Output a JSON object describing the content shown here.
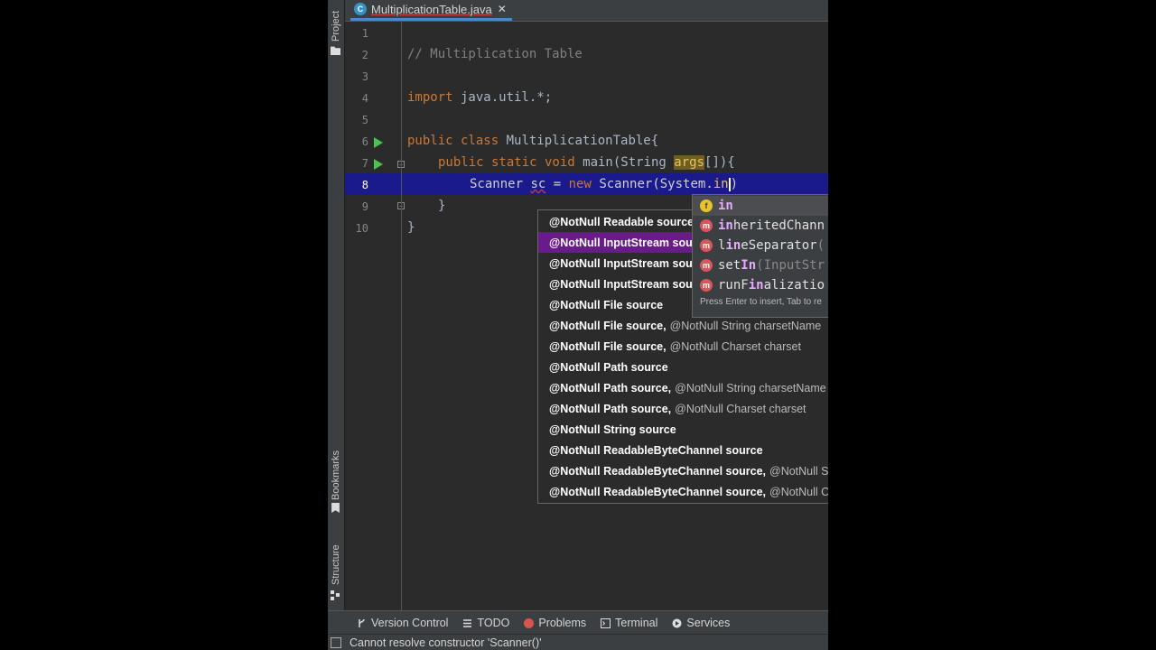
{
  "toolstrip": {
    "project_label": "Project",
    "bookmarks_label": "Bookmarks",
    "structure_label": "Structure"
  },
  "tab": {
    "file_name": "MultiplicationTable.java",
    "icon_letter": "C"
  },
  "line_numbers": [
    "1",
    "2",
    "3",
    "4",
    "5",
    "6",
    "7",
    "8",
    "9",
    "10"
  ],
  "code": {
    "l2": "// Multiplication Table",
    "l4_kw": "import",
    "l4_rest": " java.util.*;",
    "l6_kw": "public class",
    "l6_rest": " MultiplicationTable{",
    "l7_kw": "public static void",
    "l7_a": " main(String ",
    "l7_hl": "args",
    "l7_b": "[]){",
    "l8_a": "Scanner ",
    "l8_err": "sc",
    "l8_b": " = ",
    "l8_kw": "new",
    "l8_c": " Scanner(System.",
    "l8_typed": "in",
    "l8_d": ")",
    "l9": "}",
    "l10": "}"
  },
  "param_hints": [
    {
      "bold": "@NotNull Readable source",
      "rest": ""
    },
    {
      "bold": "@NotNull InputStream sou",
      "rest": ""
    },
    {
      "bold": "@NotNull InputStream sou",
      "rest": ""
    },
    {
      "bold": "@NotNull InputStream sou",
      "rest": ""
    },
    {
      "bold": "@NotNull File source",
      "rest": ""
    },
    {
      "bold": "@NotNull File source,",
      "rest": "@NotNull String charsetName"
    },
    {
      "bold": "@NotNull File source,",
      "rest": "@NotNull Charset charset"
    },
    {
      "bold": "@NotNull Path source",
      "rest": ""
    },
    {
      "bold": "@NotNull Path source,",
      "rest": "@NotNull String charsetName"
    },
    {
      "bold": "@NotNull Path source,",
      "rest": "@NotNull Charset charset"
    },
    {
      "bold": "@NotNull String source",
      "rest": ""
    },
    {
      "bold": "@NotNull ReadableByteChannel source",
      "rest": ""
    },
    {
      "bold": "@NotNull ReadableByteChannel source,",
      "rest": "@NotNull S"
    },
    {
      "bold": "@NotNull ReadableByteChannel source,",
      "rest": "@NotNull C"
    }
  ],
  "completion": {
    "items": [
      {
        "icon": "f",
        "match": "in",
        "rest": "",
        "extra": ""
      },
      {
        "icon": "m",
        "match": "in",
        "rest": "heritedChann",
        "extra": ""
      },
      {
        "icon": "m",
        "pre": "l",
        "match": "in",
        "rest": "eSeparator",
        "extra": "("
      },
      {
        "icon": "m",
        "pre": "set",
        "match": "In",
        "rest": "",
        "extra": "(InputStr"
      },
      {
        "icon": "m",
        "pre": "runF",
        "match": "in",
        "rest": "alizatio",
        "extra": ""
      }
    ],
    "hint": "Press Enter to insert, Tab to re"
  },
  "bottom_tools": [
    "Version Control",
    "TODO",
    "Problems",
    "Terminal",
    "Services"
  ],
  "status": "Cannot resolve constructor 'Scanner()'",
  "colors": {
    "keyword": "#cc7832",
    "comment": "#808080",
    "current_line": "#1a1a8c",
    "selected_param": "#6a1b8a"
  }
}
